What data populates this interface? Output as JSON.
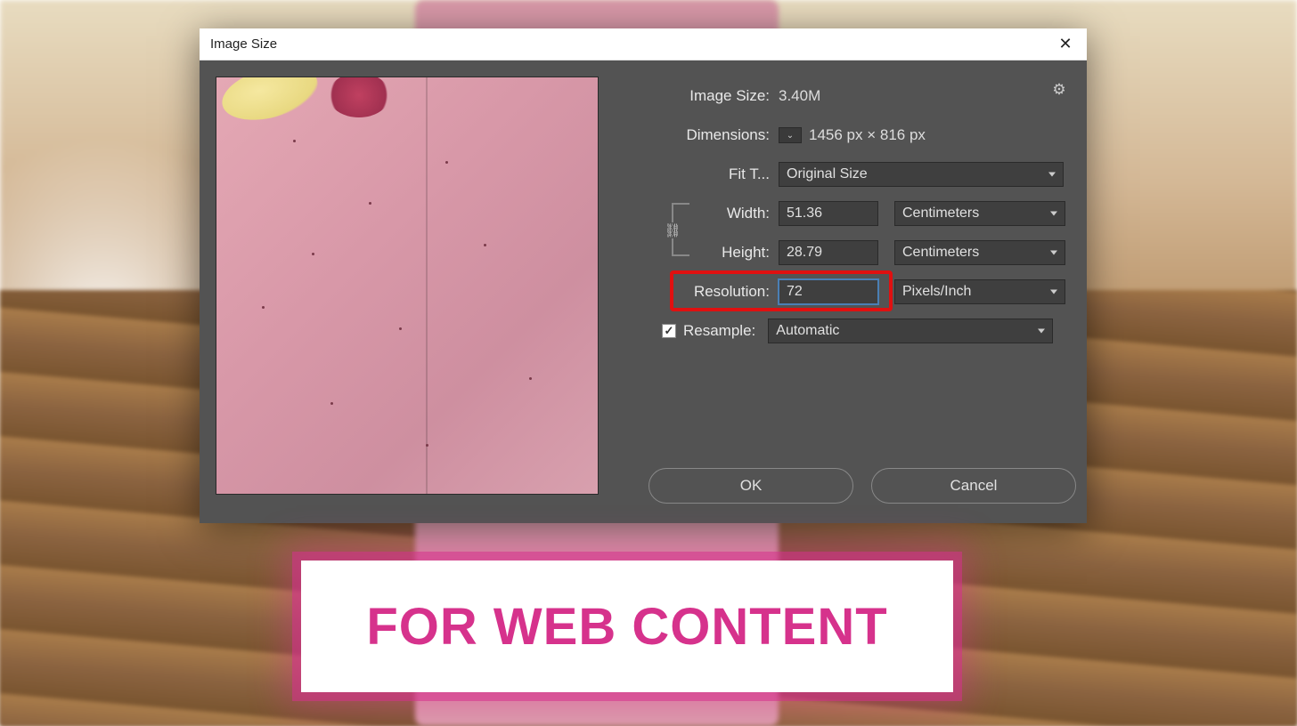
{
  "dialog": {
    "title": "Image Size",
    "close_glyph": "✕",
    "gear_glyph": "⚙",
    "labels": {
      "image_size": "Image Size:",
      "dimensions": "Dimensions:",
      "fit_to": "Fit T...",
      "width": "Width:",
      "height": "Height:",
      "resolution": "Resolution:",
      "resample": "Resample:"
    },
    "values": {
      "image_size": "3.40M",
      "dimensions": "1456 px  ×  816 px",
      "fit_to": "Original Size",
      "width": "51.36",
      "height": "28.79",
      "resolution": "72",
      "width_unit": "Centimeters",
      "height_unit": "Centimeters",
      "resolution_unit": "Pixels/Inch",
      "resample_mode": "Automatic"
    },
    "resample_checked": "✓",
    "link_glyph": "⛓",
    "chevron_glyph": "⌄",
    "buttons": {
      "ok": "OK",
      "cancel": "Cancel"
    }
  },
  "caption": "FOR WEB CONTENT"
}
